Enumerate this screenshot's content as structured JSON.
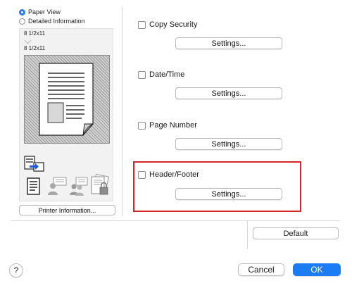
{
  "view_options": {
    "paper_view": "Paper View",
    "detailed_information": "Detailed Information",
    "selected": "paper_view"
  },
  "preview": {
    "paper_size_top": "8 1/2x11",
    "paper_size_bottom": "8 1/2x11"
  },
  "printer_information_button": "Printer Information...",
  "options": [
    {
      "label": "Copy Security",
      "checked": false,
      "settings_label": "Settings..."
    },
    {
      "label": "Date/Time",
      "checked": false,
      "settings_label": "Settings..."
    },
    {
      "label": "Page Number",
      "checked": false,
      "settings_label": "Settings..."
    },
    {
      "label": "Header/Footer",
      "checked": false,
      "settings_label": "Settings..."
    }
  ],
  "default_button": "Default",
  "help_button": "?",
  "cancel_button": "Cancel",
  "ok_button": "OK",
  "colors": {
    "accent": "#1c7cf4",
    "highlight_border": "#d3272b"
  }
}
